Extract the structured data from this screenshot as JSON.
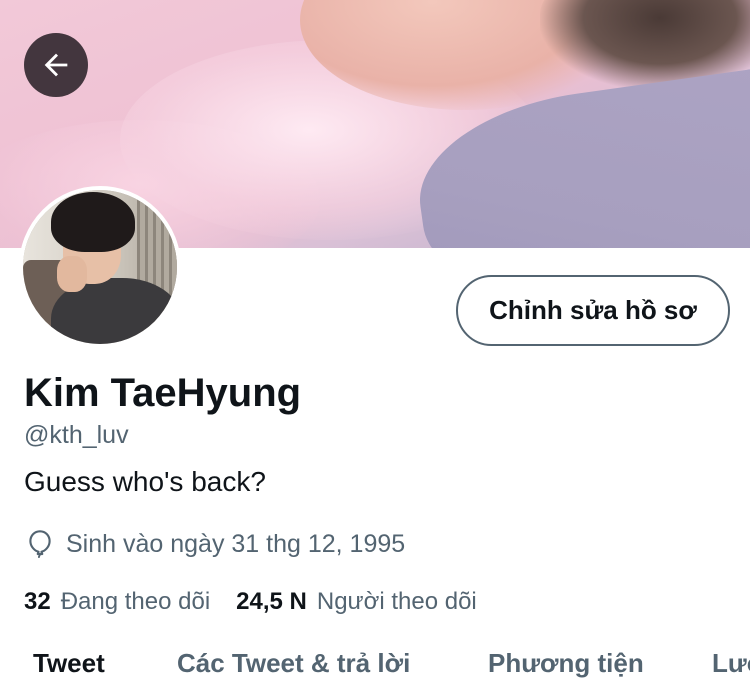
{
  "header": {
    "back_icon": "arrow-left-icon"
  },
  "profile": {
    "edit_button_label": "Chỉnh sửa hồ sơ",
    "display_name": "Kim TaeHyung",
    "handle": "@kth_luv",
    "bio": "Guess who's back?",
    "birthday_icon": "balloon-icon",
    "birthday": "Sinh vào ngày 31 thg 12, 1995",
    "following_count": "32",
    "following_label": "Đang theo dõi",
    "followers_count": "24,5 N",
    "followers_label": "Người theo dõi"
  },
  "tabs": [
    {
      "label": "Tweet",
      "active": true
    },
    {
      "label": "Các Tweet & trả lời",
      "active": false
    },
    {
      "label": "Phương tiện",
      "active": false
    },
    {
      "label": "Lượt thích",
      "active": false
    }
  ],
  "colors": {
    "primary_text": "#0f1419",
    "secondary_text": "#536471",
    "button_border": "#536471",
    "background": "#ffffff"
  }
}
